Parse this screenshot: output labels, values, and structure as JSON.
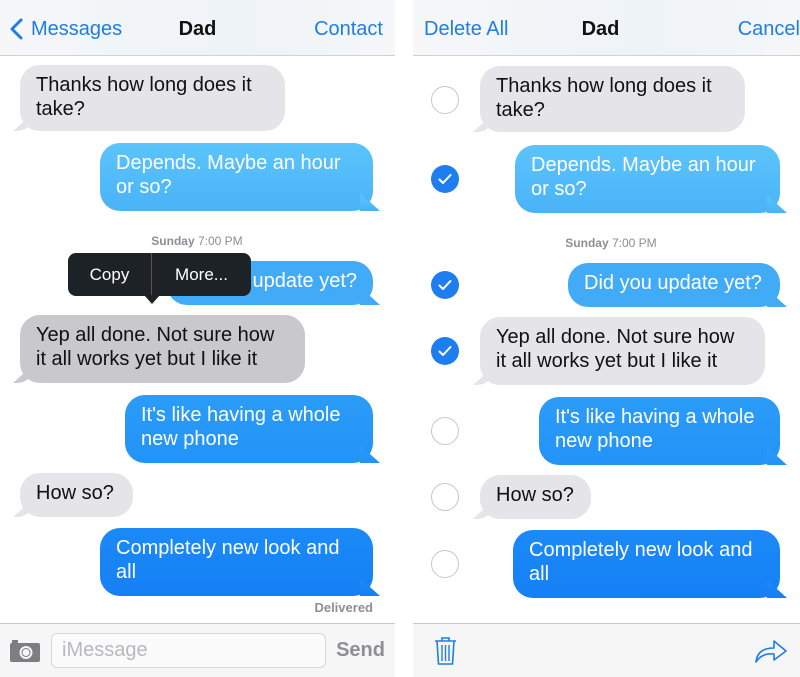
{
  "colors": {
    "accent": "#1f7de6",
    "outgoing_top": "#5ac8fa",
    "outgoing_bottom": "#1a82f7",
    "incoming": "#e4e4e9",
    "incoming_highlighted": "#c8c8cd",
    "popup": "#1d2226",
    "check_on": "#1e7ef0"
  },
  "left_screen": {
    "nav": {
      "back_label": "Messages",
      "title": "Dad",
      "right_label": "Contact"
    },
    "timestamp": {
      "day": "Sunday",
      "time": "7:00 PM"
    },
    "context_menu": {
      "copy_label": "Copy",
      "more_label": "More..."
    },
    "messages": [
      {
        "direction": "incoming",
        "text_line1": "Thanks how long does it",
        "text_line2": "take?"
      },
      {
        "direction": "outgoing",
        "text_line1": "Depends. Maybe an hour",
        "text_line2": "or so?"
      },
      {
        "direction": "outgoing",
        "text_line1": "Did you update yet?",
        "visible_text": "update yet?"
      },
      {
        "direction": "incoming",
        "highlighted": true,
        "text_line1": "Yep all done. Not sure how",
        "text_line2": "it all works yet but I like it"
      },
      {
        "direction": "outgoing",
        "text_line1": "It's like having a whole",
        "text_line2": "new phone"
      },
      {
        "direction": "incoming",
        "text_line1": "How so?"
      },
      {
        "direction": "outgoing",
        "text_line1": "Completely new look and",
        "text_line2": "all"
      }
    ],
    "status": "Delivered",
    "composer": {
      "placeholder": "iMessage",
      "value": "",
      "send_label": "Send",
      "camera_icon": "camera-icon"
    }
  },
  "right_screen": {
    "nav": {
      "left_label": "Delete All",
      "title": "Dad",
      "right_label": "Cancel"
    },
    "timestamp": {
      "day": "Sunday",
      "time": "7:00 PM"
    },
    "messages": [
      {
        "direction": "incoming",
        "selected": false,
        "text_line1": "Thanks how long does it",
        "text_line2": "take?"
      },
      {
        "direction": "outgoing",
        "selected": true,
        "text_line1": "Depends. Maybe an hour",
        "text_line2": "or so?"
      },
      {
        "direction": "outgoing",
        "selected": true,
        "text_line1": "Did you update yet?"
      },
      {
        "direction": "incoming",
        "selected": true,
        "text_line1": "Yep all done. Not sure how",
        "text_line2": "it all works yet but I like it"
      },
      {
        "direction": "outgoing",
        "selected": false,
        "text_line1": "It's like having a whole",
        "text_line2": "new phone"
      },
      {
        "direction": "incoming",
        "selected": false,
        "text_line1": "How so?"
      },
      {
        "direction": "outgoing",
        "selected": false,
        "text_line1": "Completely new look and",
        "text_line2": "all"
      }
    ],
    "toolbar": {
      "delete_icon": "trash-icon",
      "forward_icon": "share-arrow-icon"
    }
  }
}
